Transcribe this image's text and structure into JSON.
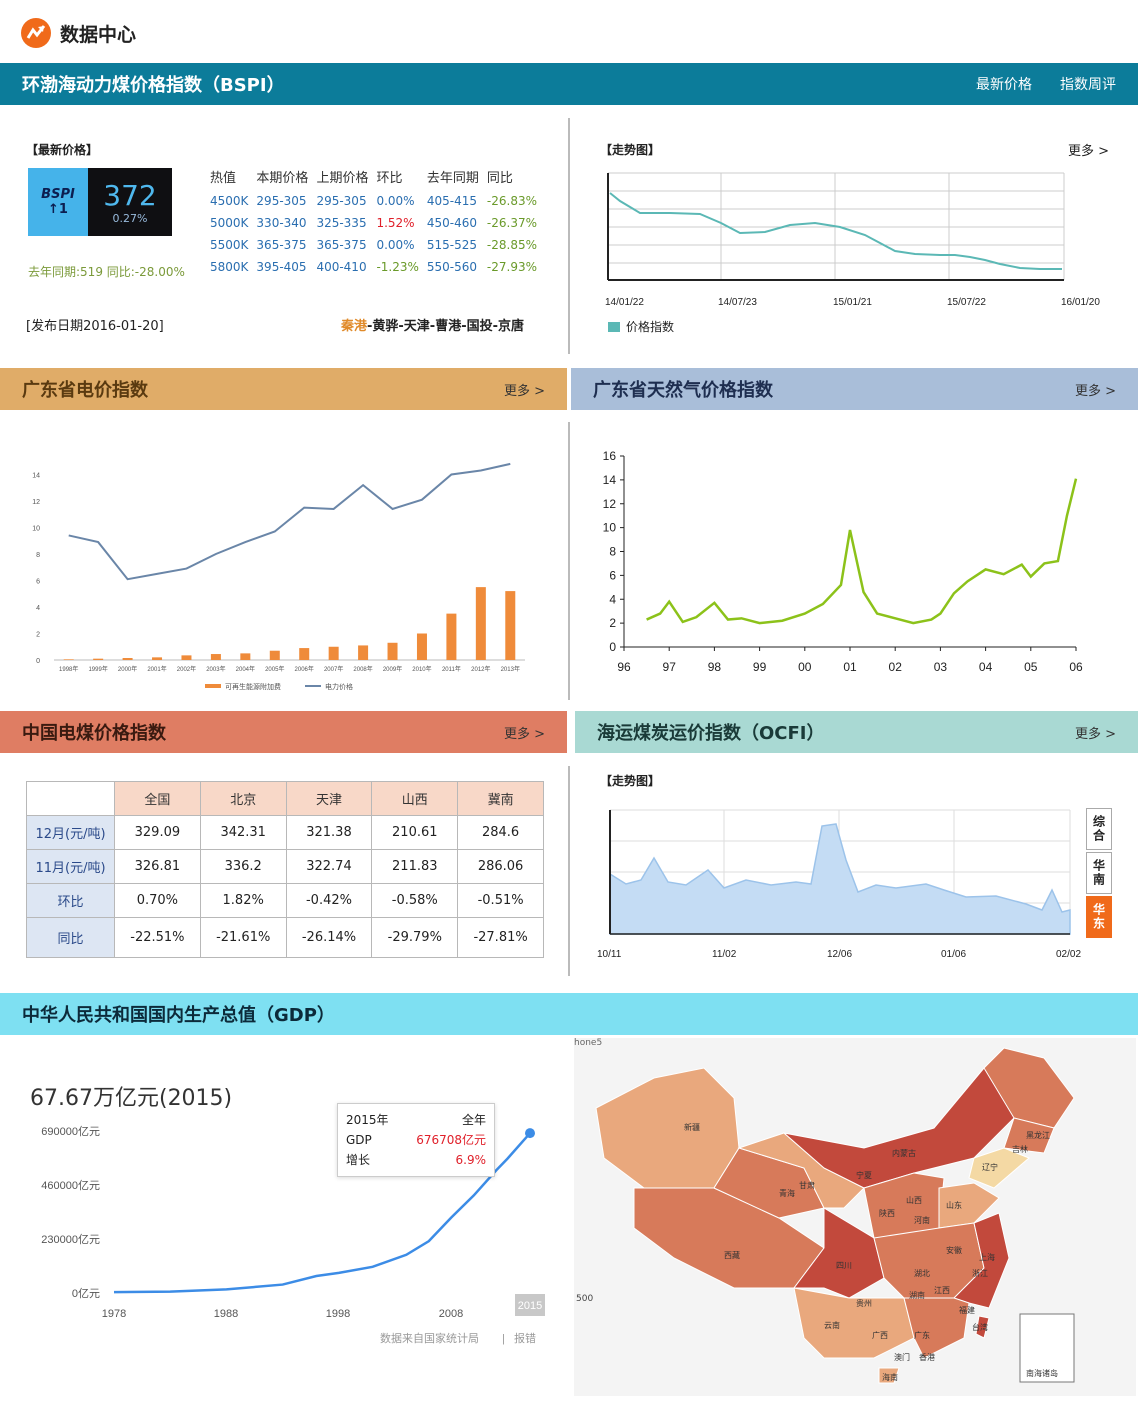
{
  "top": {
    "title": "数据中心"
  },
  "bspi": {
    "header": "环渤海动力煤价格指数（BSPI）",
    "links": [
      "最新价格",
      "指数周评"
    ],
    "latest_label": "【最新价格】",
    "badge_name": "BSPI",
    "badge_change": "↑1",
    "badge_value": "372",
    "badge_pct": "0.27%",
    "yoy_note": "去年同期:519  同比:-28.00%",
    "columns": [
      "热值",
      "本期价格",
      "上期价格",
      "环比",
      "去年同期",
      "同比"
    ],
    "rows": [
      [
        "4500K",
        "295-305",
        "295-305",
        "0.00%",
        "405-415",
        "-26.83%"
      ],
      [
        "5000K",
        "330-340",
        "325-335",
        "1.52%",
        "450-460",
        "-26.37%"
      ],
      [
        "5500K",
        "365-375",
        "365-375",
        "0.00%",
        "515-525",
        "-28.85%"
      ],
      [
        "5800K",
        "395-405",
        "400-410",
        "-1.23%",
        "550-560",
        "-27.93%"
      ]
    ],
    "publish_date": "[发布日期2016-01-20]",
    "ports_highlight": "秦港",
    "ports_rest": "-黄骅-天津-曹港-国投-京唐",
    "trend_label": "【走势图】",
    "more": "更多 >",
    "trend_ticks": [
      "14/01/22",
      "14/07/23",
      "15/01/21",
      "15/07/22",
      "16/01/20"
    ],
    "trend_legend": "价格指数"
  },
  "gd_elec": {
    "header": "广东省电价指数",
    "more": "更多 >",
    "chart_data": {
      "type": "bar",
      "categories": [
        "1998年",
        "1999年",
        "2000年",
        "2001年",
        "2002年",
        "2003年",
        "2004年",
        "2005年",
        "2006年",
        "2007年",
        "2008年",
        "2009年",
        "2010年",
        "2011年",
        "2012年",
        "2013年"
      ],
      "series": [
        {
          "name": "可再生能源附加费",
          "type": "bar",
          "values": [
            0.05,
            0.1,
            0.15,
            0.2,
            0.35,
            0.45,
            0.5,
            0.7,
            0.9,
            1.0,
            1.1,
            1.3,
            2.0,
            3.5,
            5.5,
            5.2
          ]
        },
        {
          "name": "电力价格",
          "type": "line",
          "values": [
            9.4,
            8.9,
            6.1,
            6.5,
            6.9,
            8.0,
            8.9,
            9.7,
            11.5,
            11.4,
            13.2,
            11.4,
            12.1,
            14.0,
            14.3,
            14.8
          ]
        }
      ],
      "ylim": [
        0,
        16
      ],
      "yticks": [
        0,
        2,
        4,
        6,
        8,
        10,
        12,
        14
      ],
      "legend_position": "bottom"
    }
  },
  "gd_gas": {
    "header": "广东省天然气价格指数",
    "more": "更多 >",
    "chart_data": {
      "type": "line",
      "x": [
        96.5,
        96.8,
        97.0,
        97.3,
        97.6,
        98.0,
        98.3,
        98.6,
        99.0,
        99.5,
        100.0,
        100.4,
        100.8,
        101.0,
        101.3,
        101.6,
        102.0,
        102.4,
        102.8,
        103.0,
        103.3,
        103.6,
        104.0,
        104.4,
        104.8,
        105.0,
        105.3,
        105.6,
        105.8,
        106.0
      ],
      "values": [
        2.3,
        2.8,
        3.8,
        2.1,
        2.5,
        3.7,
        2.3,
        2.4,
        2.0,
        2.2,
        2.8,
        3.6,
        5.2,
        9.8,
        4.6,
        2.8,
        2.4,
        2.0,
        2.3,
        2.8,
        4.5,
        5.5,
        6.5,
        6.1,
        6.9,
        5.9,
        7.0,
        7.2,
        11.0,
        14.1
      ],
      "ylim": [
        0,
        16
      ],
      "yticks": [
        0,
        2,
        4,
        6,
        8,
        10,
        12,
        14,
        16
      ],
      "xticks": [
        "96",
        "97",
        "98",
        "99",
        "00",
        "01",
        "02",
        "03",
        "04",
        "05",
        "06"
      ],
      "grid": false
    }
  },
  "coal_index": {
    "header": "中国电煤价格指数",
    "more": "更多 >",
    "columns": [
      "全国",
      "北京",
      "天津",
      "山西",
      "冀南"
    ],
    "rows": [
      {
        "label": "12月(元/吨)",
        "values": [
          "329.09",
          "342.31",
          "321.38",
          "210.61",
          "284.6"
        ]
      },
      {
        "label": "11月(元/吨)",
        "values": [
          "326.81",
          "336.2",
          "322.74",
          "211.83",
          "286.06"
        ]
      },
      {
        "label": "环比",
        "values": [
          "0.70%",
          "1.82%",
          "-0.42%",
          "-0.58%",
          "-0.51%"
        ]
      },
      {
        "label": "同比",
        "values": [
          "-22.51%",
          "-21.61%",
          "-26.14%",
          "-29.79%",
          "-27.81%"
        ]
      }
    ]
  },
  "ocfi": {
    "header": "海运煤炭运价指数（OCFI）",
    "more": "更多 >",
    "trend_label": "【走势图】",
    "xticks": [
      "10/11",
      "11/02",
      "12/06",
      "01/06",
      "02/02"
    ],
    "tabs": [
      "综合",
      "华南",
      "华东"
    ]
  },
  "gdp": {
    "header": "中华人民共和国国内生产总值（GDP）",
    "headline": "67.67万亿元(2015)",
    "tooltip": {
      "year": "2015年",
      "period": "全年",
      "gdp_label": "GDP",
      "gdp_value": "676708亿元",
      "growth_label": "增长",
      "growth_value": "6.9%"
    },
    "yticks": [
      "690000亿元",
      "460000亿元",
      "230000亿元",
      "0亿元"
    ],
    "xticks": [
      "1978",
      "1988",
      "1998",
      "2008",
      "2015"
    ],
    "source": "数据来自国家统计局",
    "report": "报错",
    "chart_data": {
      "type": "line",
      "x": [
        1978,
        1983,
        1988,
        1993,
        1996,
        1998,
        2001,
        2004,
        2006,
        2008,
        2010,
        2012,
        2013,
        2015
      ],
      "values": [
        3645,
        5976,
        15180,
        35673,
        71814,
        85196,
        110863,
        161840,
        219439,
        319516,
        413030,
        519470,
        568845,
        676708
      ],
      "ylim": [
        0,
        690000
      ]
    }
  },
  "map": {
    "corner_label": "hone5",
    "scale_label": "500",
    "inset_label": "南海诸岛",
    "provinces": [
      "黑龙江",
      "吉林",
      "辽宁",
      "内蒙古",
      "新疆",
      "青海",
      "甘肃",
      "宁夏",
      "陕西",
      "山西",
      "河南",
      "山东",
      "四川",
      "西藏",
      "云南",
      "贵州",
      "广西",
      "广东",
      "福建",
      "江西",
      "湖南",
      "湖北",
      "安徽",
      "浙江",
      "上海",
      "香港",
      "澳门",
      "海南",
      "台湾"
    ],
    "colors": {
      "dark": "#c2493c",
      "mid": "#d77a5a",
      "light": "#e9a87d",
      "pale": "#f4d9a4"
    }
  },
  "colors": {
    "bspi_header": "#0c7c9a",
    "gd_elec_header": "#e0ac68",
    "gd_gas_header": "#a9bed9",
    "coal_header": "#df7d63",
    "ocfi_header": "#a9d9d3",
    "gdp_header": "#7ee0f2"
  }
}
